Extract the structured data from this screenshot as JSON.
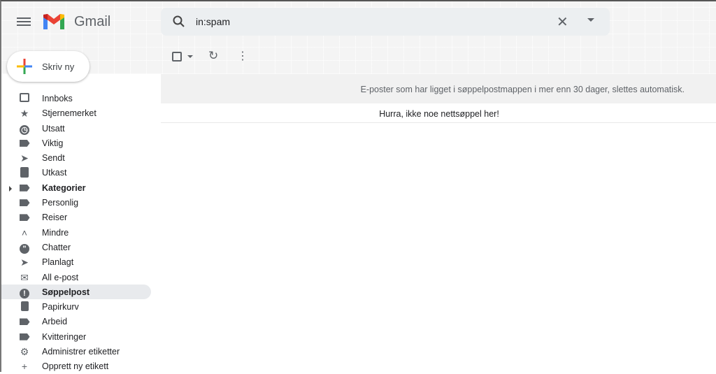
{
  "header": {
    "brand": "Gmail",
    "search_value": "in:spam"
  },
  "compose_label": "Skriv ny",
  "notice": "E-poster som har ligget i søppelpostmappen i mer enn 30 dager, slettes automatisk.",
  "empty_message": "Hurra, ikke noe nettsøppel her!",
  "nav": [
    {
      "label": "Innboks",
      "icon": "inbox"
    },
    {
      "label": "Stjernemerket",
      "icon": "star"
    },
    {
      "label": "Utsatt",
      "icon": "clock"
    },
    {
      "label": "Viktig",
      "icon": "important"
    },
    {
      "label": "Sendt",
      "icon": "send"
    },
    {
      "label": "Utkast",
      "icon": "draft"
    },
    {
      "label": "Kategorier",
      "icon": "label"
    },
    {
      "label": "Personlig",
      "icon": "label"
    },
    {
      "label": "Reiser",
      "icon": "label"
    },
    {
      "label": "Mindre",
      "icon": "chevron-up"
    },
    {
      "label": "Chatter",
      "icon": "chat"
    },
    {
      "label": "Planlagt",
      "icon": "scheduled"
    },
    {
      "label": "All e-post",
      "icon": "mail"
    },
    {
      "label": "Søppelpost",
      "icon": "spam"
    },
    {
      "label": "Papirkurv",
      "icon": "trash"
    },
    {
      "label": "Arbeid",
      "icon": "label"
    },
    {
      "label": "Kvitteringer",
      "icon": "label"
    },
    {
      "label": "Administrer etiketter",
      "icon": "gear"
    },
    {
      "label": "Opprett ny etikett",
      "icon": "plus"
    }
  ]
}
